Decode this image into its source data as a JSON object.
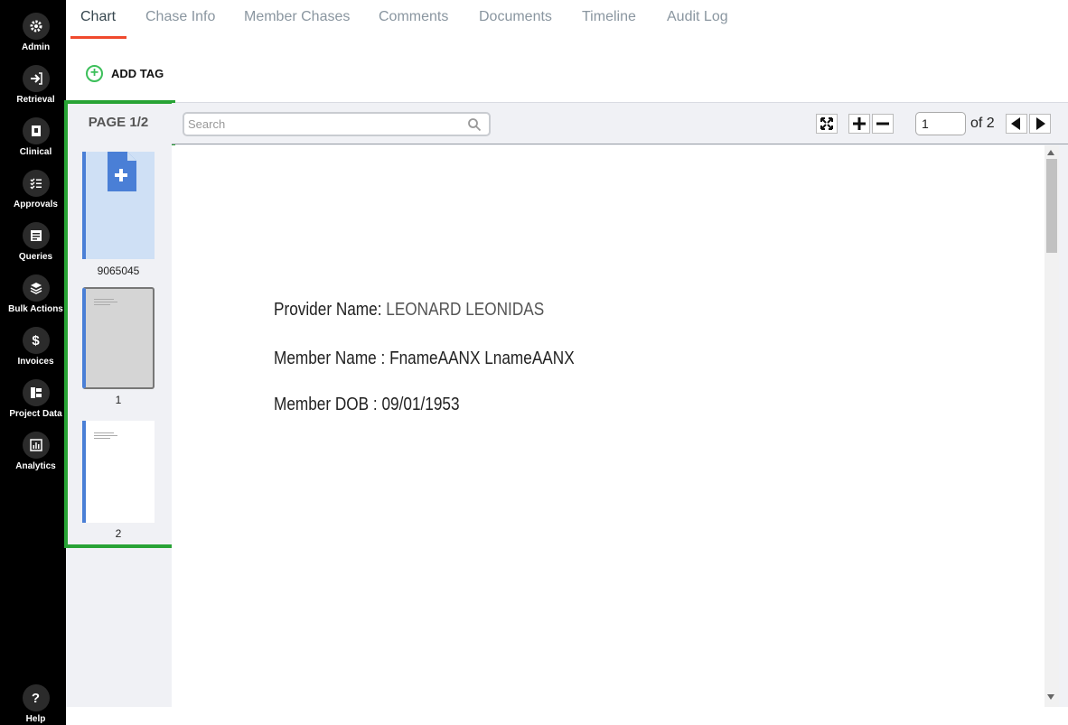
{
  "sidebar": {
    "items": [
      {
        "label": "Admin"
      },
      {
        "label": "Retrieval"
      },
      {
        "label": "Clinical"
      },
      {
        "label": "Approvals"
      },
      {
        "label": "Queries"
      },
      {
        "label": "Bulk Actions"
      },
      {
        "label": "Invoices"
      },
      {
        "label": "Project Data"
      },
      {
        "label": "Analytics"
      }
    ],
    "help": {
      "label": "Help",
      "glyph": "?"
    },
    "invoice_glyph": "$"
  },
  "tabs": [
    "Chart",
    "Chase Info",
    "Member Chases",
    "Comments",
    "Documents",
    "Timeline",
    "Audit Log"
  ],
  "active_tab": "Chart",
  "add_tag": {
    "icon": "+",
    "label": "ADD TAG"
  },
  "thumbnails": {
    "page_indicator": "PAGE 1/2",
    "items": [
      {
        "caption": "9065045"
      },
      {
        "caption": "1"
      },
      {
        "caption": "2"
      }
    ]
  },
  "toolbar": {
    "search_placeholder": "Search",
    "current_page": "1",
    "total_label": "of 2"
  },
  "document": {
    "provider_label": "Provider Name:",
    "provider_value": "LEONARD LEONIDAS",
    "member_label": "Member Name :",
    "member_value": "FnameAANX LnameAANX",
    "dob_label": "Member DOB :",
    "dob_value": "09/01/1953"
  },
  "colors": {
    "sidebar_bg": "#000000",
    "tab_active_underline": "#f0492d",
    "highlight_border": "#28a335",
    "thumb_accent": "#4a7fd6",
    "add_tag_green": "#3cbf5a"
  }
}
